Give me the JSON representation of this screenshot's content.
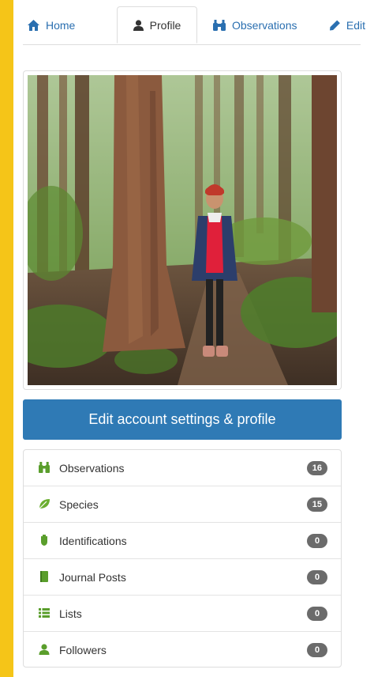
{
  "tabs": [
    {
      "label": "Home",
      "icon": "home-icon",
      "active": false
    },
    {
      "label": "Profile",
      "icon": "user-icon",
      "active": true
    },
    {
      "label": "Observations",
      "icon": "binoculars-icon",
      "active": false
    },
    {
      "label": "Edit",
      "icon": "pencil-icon",
      "active": false
    }
  ],
  "profile_photo": {
    "icon": "profile-photo"
  },
  "edit_button": {
    "label": "Edit account settings & profile"
  },
  "stats": [
    {
      "label": "Observations",
      "count": "16",
      "icon": "binoculars-icon",
      "icon_color": "#5a9e2c"
    },
    {
      "label": "Species",
      "count": "15",
      "icon": "leaf-icon",
      "icon_color": "#6aae2f"
    },
    {
      "label": "Identifications",
      "count": "0",
      "icon": "shield-icon",
      "icon_color": "#5a9e2c"
    },
    {
      "label": "Journal Posts",
      "count": "0",
      "icon": "book-icon",
      "icon_color": "#5a9e2c"
    },
    {
      "label": "Lists",
      "count": "0",
      "icon": "list-icon",
      "icon_color": "#5a9e2c"
    },
    {
      "label": "Followers",
      "count": "0",
      "icon": "user-icon",
      "icon_color": "#5a9e2c"
    }
  ],
  "colors": {
    "background": "#f5c518",
    "accent": "#2f7ab5",
    "link": "#2a6fb0",
    "badge": "#6b6b6b",
    "icon_green": "#5a9e2c"
  }
}
